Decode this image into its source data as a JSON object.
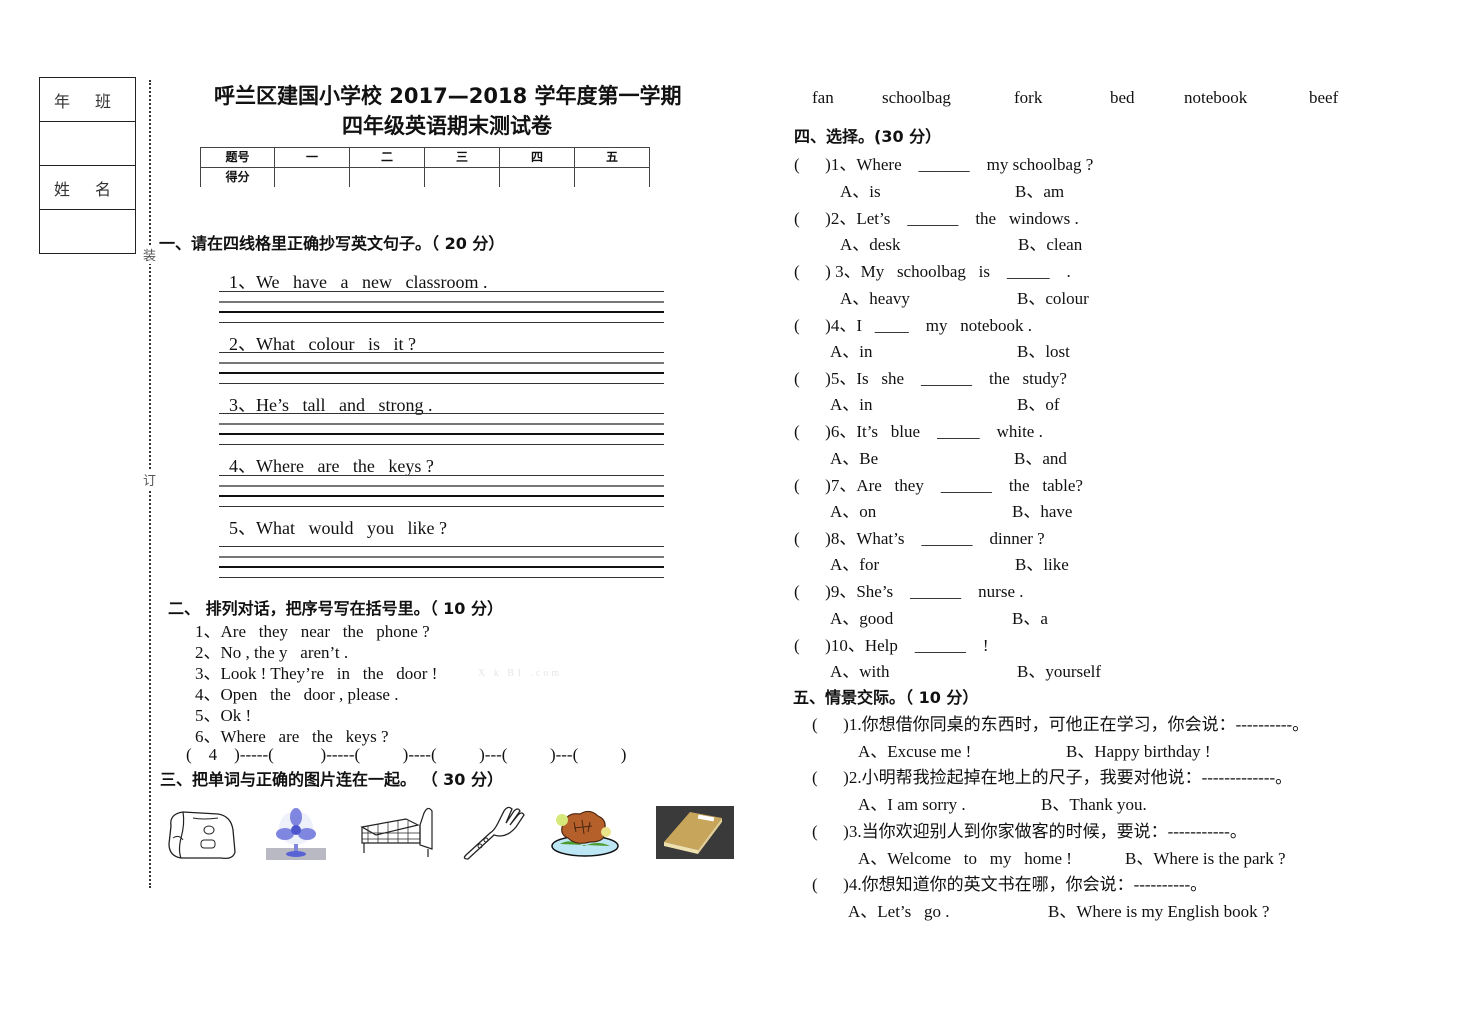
{
  "sidebar": {
    "class_label": "年 班",
    "name_label": "姓 名",
    "binding_marks": [
      "装",
      "订"
    ]
  },
  "header": {
    "title_line1": "呼兰区建国小学校 2017—2018 学年度第一学期",
    "title_line2": "四年级英语期末测试卷"
  },
  "score_table": {
    "header_row": [
      "题号",
      "一",
      "二",
      "三",
      "四",
      "五"
    ],
    "score_row": [
      "得分",
      "",
      "",
      "",
      "",
      ""
    ]
  },
  "section1": {
    "heading": "一、请在四线格里正确抄写英文句子。（ 20 分）",
    "sentences": [
      "1、We   have   a   new   classroom .",
      "2、What   colour   is   it ?",
      "3、He’s   tall   and   strong .",
      "4、Where   are   the   keys ?",
      "5、What   would   you   like ?"
    ]
  },
  "section2": {
    "heading": "二、 排列对话，把序号写在括号里。（ 10 分）",
    "lines": [
      "1、Are   they   near   the   phone ?",
      "2、No , the y   aren’t .",
      "3、Look ! They’re   in   the   door !",
      "4、Open   the   door , please .",
      "5、Ok !",
      "6、Where   are   the   keys ?"
    ],
    "watermark": "X k B1 .com",
    "answer_sequence": "(    4    )-----(           )-----(          )----(          )---(          )---(          )"
  },
  "section3": {
    "heading": "三、把单词与正确的图片连在一起。   （ 30 分）",
    "pictures": [
      "schoolbag",
      "fan",
      "bed",
      "fork",
      "beef",
      "notebook"
    ],
    "words": [
      "fan",
      "schoolbag",
      "fork",
      "bed",
      "notebook",
      "beef"
    ]
  },
  "section4": {
    "heading": "四、选择。(30 分）",
    "questions": [
      {
        "q": "(      )1、Where    ______    my schoolbag ?",
        "a": "A、is",
        "b": "B、am"
      },
      {
        "q": "(      )2、Let’s    ______    the   windows .",
        "a": "A、desk",
        "b": "B、clean"
      },
      {
        "q": "(      ) 3、My   schoolbag   is    _____    .",
        "a": "A、heavy",
        "b": "B、colour"
      },
      {
        "q": "(      )4、I   ____    my   notebook .",
        "a": "A、in",
        "b": "B、lost"
      },
      {
        "q": "(      )5、Is   she    ______    the   study?",
        "a": "A、in",
        "b": "B、of"
      },
      {
        "q": "(      )6、It’s   blue    _____    white .",
        "a": "A、Be",
        "b": "B、and"
      },
      {
        "q": "(      )7、Are   they    ______    the   table?",
        "a": "A、on",
        "b": "B、have"
      },
      {
        "q": "(      )8、What’s    ______    dinner ?",
        "a": "A、for",
        "b": "B、like"
      },
      {
        "q": "(      )9、She’s    ______    nurse .",
        "a": "A、good",
        "b": "B、a"
      },
      {
        "q": "(      )10、Help    ______    !",
        "a": "A、with",
        "b": "B、yourself"
      }
    ]
  },
  "section5": {
    "heading": "五、情景交际。（ 10 分）",
    "questions": [
      {
        "q": "(      )1.你想借你同桌的东西时，可他正在学习，你会说：----------。",
        "a": "A、Excuse me !",
        "b": "B、Happy birthday !"
      },
      {
        "q": "(      )2.小明帮我捡起掉在地上的尺子，我要对他说：-------------。",
        "a": "A、I am sorry .",
        "b": "B、Thank you."
      },
      {
        "q": "(      )3.当你欢迎别人到你家做客的时候，要说：-----------。",
        "a": "A、Welcome   to   my   home !",
        "b": "B、Where is the park ?"
      },
      {
        "q": "(      )4.你想知道你的英文书在哪，你会说：----------。",
        "a": "A、Let’s   go .",
        "b": "B、Where is my English book ?"
      }
    ]
  }
}
